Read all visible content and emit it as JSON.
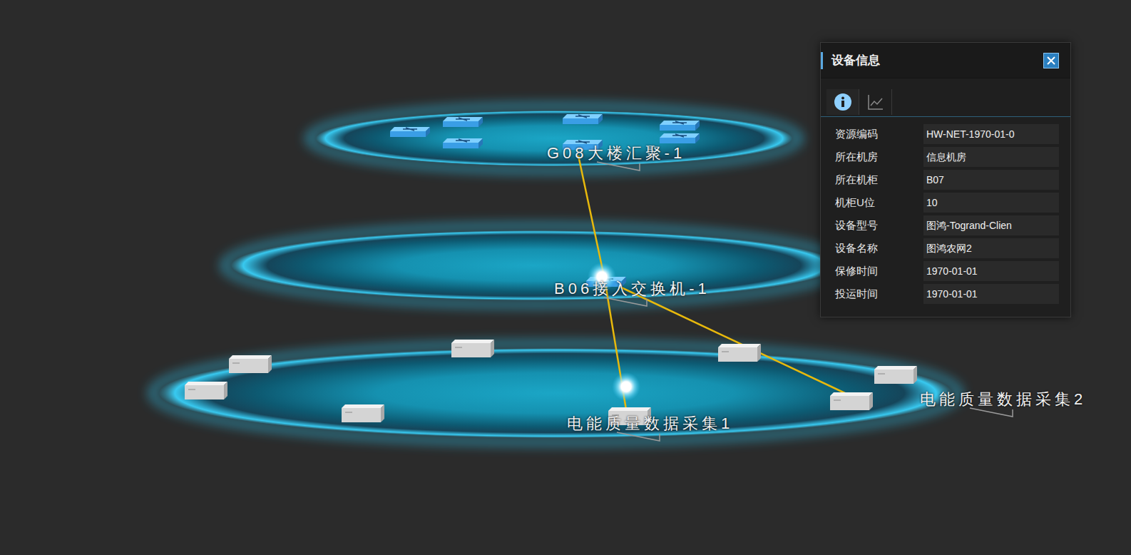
{
  "diagram": {
    "layers": [
      {
        "nodes": [
          {
            "kind": "switch",
            "label": "",
            "highlighted": false
          },
          {
            "kind": "switch",
            "label": "",
            "highlighted": false
          },
          {
            "kind": "switch",
            "label": "",
            "highlighted": false
          },
          {
            "kind": "switch",
            "label": "",
            "highlighted": false
          },
          {
            "kind": "switch",
            "label": "",
            "highlighted": false
          },
          {
            "kind": "switch",
            "label": "G08大楼汇聚-1",
            "highlighted": false
          },
          {
            "kind": "switch",
            "label": "",
            "highlighted": false
          }
        ]
      },
      {
        "nodes": [
          {
            "kind": "switch",
            "label": "B06接入交换机-1",
            "highlighted": true
          }
        ]
      },
      {
        "nodes": [
          {
            "kind": "server",
            "label": "",
            "highlighted": false
          },
          {
            "kind": "server",
            "label": "",
            "highlighted": false
          },
          {
            "kind": "server",
            "label": "",
            "highlighted": false
          },
          {
            "kind": "server",
            "label": "",
            "highlighted": false
          },
          {
            "kind": "server",
            "label": "",
            "highlighted": false
          },
          {
            "kind": "server",
            "label": "",
            "highlighted": false
          },
          {
            "kind": "server",
            "label": "电能质量数据采集1",
            "highlighted": true
          },
          {
            "kind": "server",
            "label": "电能质量数据采集2",
            "highlighted": false
          }
        ]
      }
    ],
    "links": [
      {
        "from": "B06接入交换机-1",
        "to": "G08大楼汇聚-1"
      },
      {
        "from": "B06接入交换机-1",
        "to": "电能质量数据采集1"
      },
      {
        "from": "B06接入交换机-1",
        "to": "电能质量数据采集2"
      }
    ]
  },
  "panel": {
    "title": "设备信息",
    "tabs": [
      {
        "icon": "info",
        "selected": true
      },
      {
        "icon": "chart",
        "selected": false
      }
    ],
    "fields": [
      {
        "label": "资源编码",
        "value": "HW-NET-1970-01-0"
      },
      {
        "label": "所在机房",
        "value": "信息机房"
      },
      {
        "label": "所在机柜",
        "value": "B07"
      },
      {
        "label": "机柜U位",
        "value": "10"
      },
      {
        "label": "设备型号",
        "value": "图鸿-Togrand-Clien"
      },
      {
        "label": "设备名称",
        "value": "图鸿农网2"
      },
      {
        "label": "保修时间",
        "value": "1970-01-01"
      },
      {
        "label": "投运时间",
        "value": "1970-01-01"
      }
    ]
  }
}
